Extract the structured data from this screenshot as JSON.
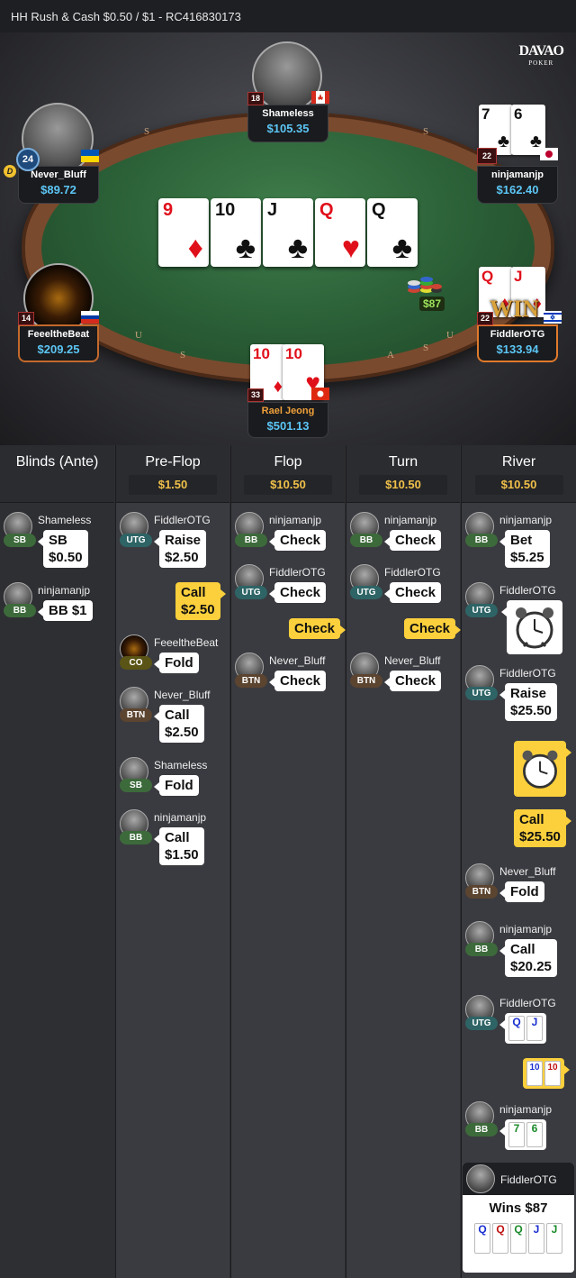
{
  "header": {
    "title": "HH  Rush & Cash $0.50 / $1   - RC416830173"
  },
  "logo": {
    "main": "DAVAO",
    "sub": "POKER"
  },
  "rail_letters": [
    "S",
    "U",
    "S",
    "A",
    "S",
    "U",
    "S"
  ],
  "board": [
    {
      "rank": "9",
      "suit": "♦",
      "color": "red"
    },
    {
      "rank": "10",
      "suit": "♣",
      "color": "blk"
    },
    {
      "rank": "J",
      "suit": "♣",
      "color": "blk"
    },
    {
      "rank": "Q",
      "suit": "♥",
      "color": "red"
    },
    {
      "rank": "Q",
      "suit": "♣",
      "color": "blk"
    }
  ],
  "pot": "$87",
  "win_text": "WIN",
  "dealer_button": "D",
  "seats": {
    "shameless": {
      "name": "Shameless",
      "stack": "$105.35",
      "level": "18"
    },
    "never_bluff": {
      "name": "Never_Bluff",
      "stack": "$89.72",
      "level": "24"
    },
    "ninjamanjp": {
      "name": "ninjamanjp",
      "stack": "$162.40",
      "level": "22",
      "cards": [
        {
          "rank": "7",
          "suit": "♣",
          "color": "blk"
        },
        {
          "rank": "6",
          "suit": "♣",
          "color": "blk"
        }
      ]
    },
    "feeeltheBeat": {
      "name": "FeeeltheBeat",
      "stack": "$209.25",
      "level": "14"
    },
    "fiddlerOTG": {
      "name": "FiddlerOTG",
      "stack": "$133.94",
      "level": "22",
      "cards": [
        {
          "rank": "Q",
          "suit": "♦",
          "color": "red"
        },
        {
          "rank": "J",
          "suit": "♦",
          "color": "red"
        }
      ]
    },
    "hero": {
      "name": "Rael Jeong",
      "stack": "$501.13",
      "level": "33",
      "cards": [
        {
          "rank": "10",
          "suit": "♦",
          "color": "red"
        },
        {
          "rank": "10",
          "suit": "♥",
          "color": "red"
        }
      ]
    }
  },
  "columns": [
    {
      "title": "Blinds (Ante)",
      "pot": ""
    },
    {
      "title": "Pre-Flop",
      "pot": "$1.50"
    },
    {
      "title": "Flop",
      "pot": "$10.50"
    },
    {
      "title": "Turn",
      "pot": "$10.50"
    },
    {
      "title": "River",
      "pot": "$10.50"
    }
  ],
  "positions": {
    "sb": "SB",
    "bb": "BB",
    "utg": "UTG",
    "co": "CO",
    "btn": "BTN"
  },
  "blinds": {
    "e1": {
      "player": "Shameless",
      "action": "SB",
      "amount": "$0.50"
    },
    "e2": {
      "player": "ninjamanjp",
      "action": "BB $1"
    }
  },
  "preflop": {
    "e1": {
      "player": "FiddlerOTG",
      "action": "Raise",
      "amount": "$2.50"
    },
    "e2": {
      "action": "Call",
      "amount": "$2.50"
    },
    "e3": {
      "player": "FeeeltheBeat",
      "action": "Fold"
    },
    "e4": {
      "player": "Never_Bluff",
      "action": "Call",
      "amount": "$2.50"
    },
    "e5": {
      "player": "Shameless",
      "action": "Fold"
    },
    "e6": {
      "player": "ninjamanjp",
      "action": "Call",
      "amount": "$1.50"
    }
  },
  "flop": {
    "e1": {
      "player": "ninjamanjp",
      "action": "Check"
    },
    "e2": {
      "player": "FiddlerOTG",
      "action": "Check"
    },
    "e3": {
      "action": "Check"
    },
    "e4": {
      "player": "Never_Bluff",
      "action": "Check"
    }
  },
  "turn": {
    "e1": {
      "player": "ninjamanjp",
      "action": "Check"
    },
    "e2": {
      "player": "FiddlerOTG",
      "action": "Check"
    },
    "e3": {
      "action": "Check"
    },
    "e4": {
      "player": "Never_Bluff",
      "action": "Check"
    }
  },
  "river": {
    "e1": {
      "player": "ninjamanjp",
      "action": "Bet",
      "amount": "$5.25"
    },
    "e2": {
      "player": "FiddlerOTG"
    },
    "e3": {
      "player": "FiddlerOTG",
      "action": "Raise",
      "amount": "$25.50"
    },
    "e5": {
      "action": "Call",
      "amount": "$25.50"
    },
    "e6": {
      "player": "Never_Bluff",
      "action": "Fold"
    },
    "e7": {
      "player": "ninjamanjp",
      "action": "Call",
      "amount": "$20.25"
    },
    "e8": {
      "player": "FiddlerOTG"
    },
    "e10": {
      "player": "ninjamanjp"
    },
    "winner": {
      "player": "FiddlerOTG",
      "text": "Wins $87"
    }
  },
  "showdown": {
    "fiddler": [
      "Q",
      "J"
    ],
    "hero": [
      "10",
      "10"
    ],
    "ninja": [
      "7",
      "6"
    ],
    "best_hand": [
      "Q",
      "Q",
      "Q",
      "J",
      "J"
    ]
  }
}
